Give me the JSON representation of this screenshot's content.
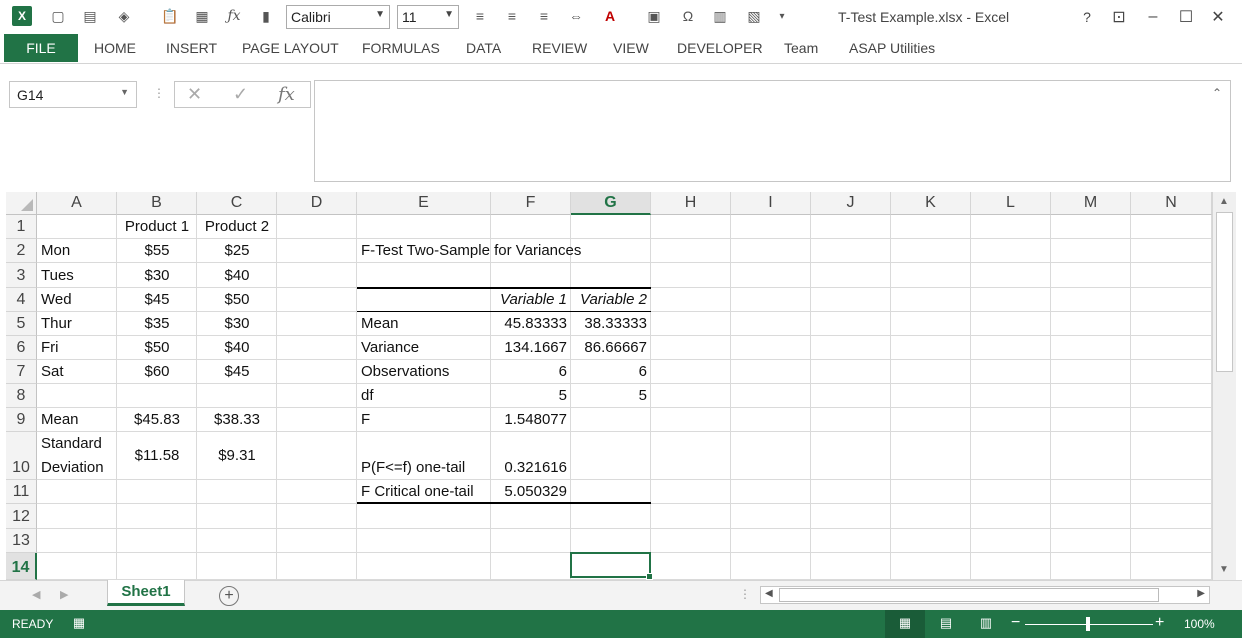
{
  "window": {
    "title": "T-Test Example.xlsx - Excel",
    "help": "?",
    "font_name": "Calibri",
    "font_size": "11"
  },
  "ribbon": {
    "file": "FILE",
    "tabs": [
      "HOME",
      "INSERT",
      "PAGE LAYOUT",
      "FORMULAS",
      "DATA",
      "REVIEW",
      "VIEW",
      "DEVELOPER",
      "Team",
      "ASAP Utilities"
    ]
  },
  "formula_bar": {
    "name_box": "G14",
    "fx": "fx",
    "value": ""
  },
  "columns": [
    "A",
    "B",
    "C",
    "D",
    "E",
    "F",
    "G",
    "H",
    "I",
    "J",
    "K",
    "L",
    "M",
    "N"
  ],
  "rows": [
    "1",
    "2",
    "3",
    "4",
    "5",
    "6",
    "7",
    "8",
    "9",
    "10",
    "11",
    "12",
    "13",
    "14"
  ],
  "selected": {
    "column": "G",
    "row": "14"
  },
  "cells": {
    "B1": "Product 1",
    "C1": "Product 2",
    "A2": "Mon",
    "B2": "$55",
    "C2": "$25",
    "E2": "F-Test Two-Sample for Variances",
    "A3": "Tues",
    "B3": "$30",
    "C3": "$40",
    "A4": "Wed",
    "B4": "$45",
    "C4": "$50",
    "F4": "Variable 1",
    "G4": "Variable 2",
    "A5": "Thur",
    "B5": "$35",
    "C5": "$30",
    "E5": "Mean",
    "F5": "45.83333",
    "G5": "38.33333",
    "A6": "Fri",
    "B6": "$50",
    "C6": "$40",
    "E6": "Variance",
    "F6": "134.1667",
    "G6": "86.66667",
    "A7": "Sat",
    "B7": "$60",
    "C7": "$45",
    "E7": "Observations",
    "F7": "6",
    "G7": "6",
    "E8": "df",
    "F8": "5",
    "G8": "5",
    "A9": "Mean",
    "B9": "$45.83",
    "C9": "$38.33",
    "E9": "F",
    "F9": "1.548077",
    "A10a": "Standard",
    "A10b": "Deviation",
    "B10": "$11.58",
    "C10": "$9.31",
    "E10": "P(F<=f) one-tail",
    "F10": "0.321616",
    "E11": "F Critical one-tail",
    "F11": "5.050329"
  },
  "sheets": [
    "Sheet1"
  ],
  "status": {
    "ready": "READY",
    "zoom": "100%"
  },
  "colors": {
    "accent": "#217346"
  }
}
